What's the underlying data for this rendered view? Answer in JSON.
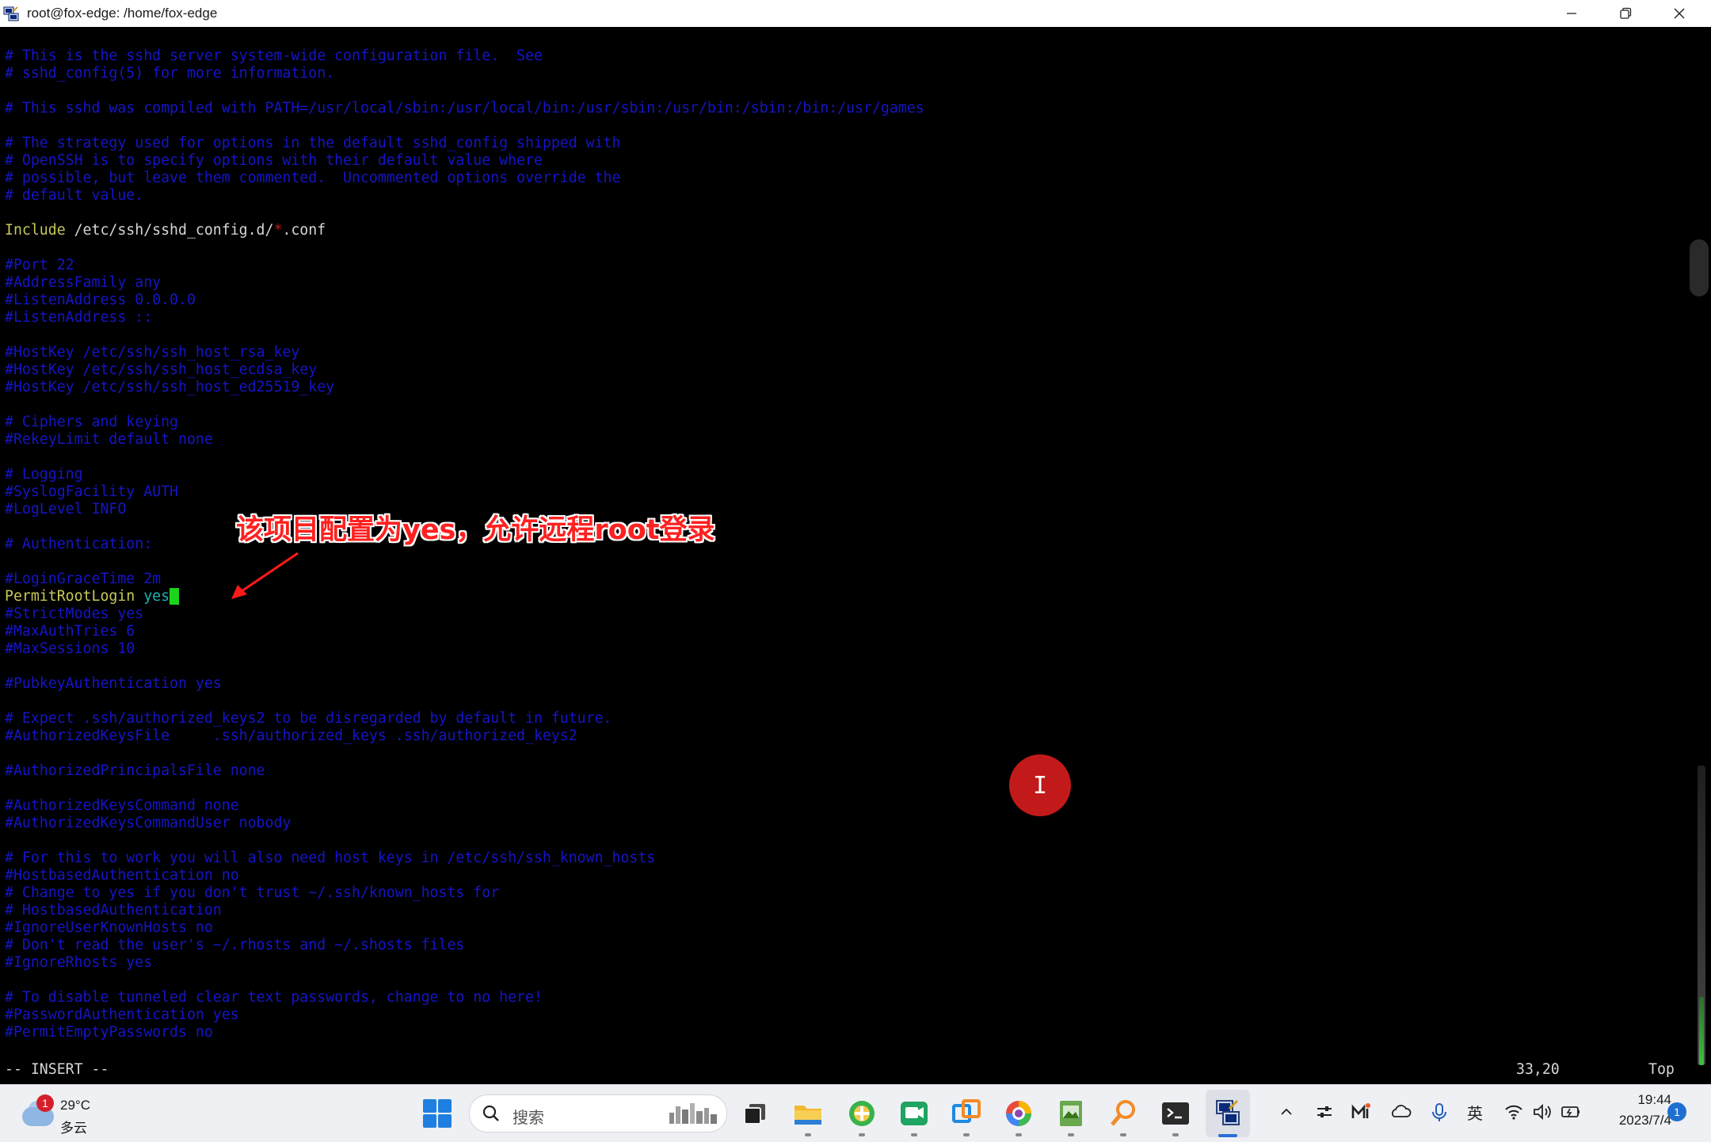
{
  "window": {
    "title": "root@fox-edge: /home/fox-edge"
  },
  "terminal": {
    "lines": [
      [
        {
          "t": "# This is the sshd server system-wide configuration file.  See",
          "c": "cm"
        }
      ],
      [
        {
          "t": "# sshd_config(5) for more information.",
          "c": "cm"
        }
      ],
      [],
      [
        {
          "t": "# This sshd was compiled with PATH=/usr/local/sbin:/usr/local/bin:/usr/sbin:/usr/bin:/sbin:/bin:/usr/games",
          "c": "cm"
        }
      ],
      [],
      [
        {
          "t": "# The strategy used for options in the default sshd_config shipped with",
          "c": "cm"
        }
      ],
      [
        {
          "t": "# OpenSSH is to specify options with their default value where",
          "c": "cm"
        }
      ],
      [
        {
          "t": "# possible, but leave them commented.  Uncommented options override the",
          "c": "cm"
        }
      ],
      [
        {
          "t": "# default value.",
          "c": "cm"
        }
      ],
      [],
      [
        {
          "t": "Include",
          "c": "kw"
        },
        {
          "t": " /etc/ssh/sshd_config.d/",
          "c": "fn"
        },
        {
          "t": "*",
          "c": "ar"
        },
        {
          "t": ".conf",
          "c": "fn"
        }
      ],
      [],
      [
        {
          "t": "#Port 22",
          "c": "cm"
        }
      ],
      [
        {
          "t": "#AddressFamily any",
          "c": "cm"
        }
      ],
      [
        {
          "t": "#ListenAddress 0.0.0.0",
          "c": "cm"
        }
      ],
      [
        {
          "t": "#ListenAddress ::",
          "c": "cm"
        }
      ],
      [],
      [
        {
          "t": "#HostKey /etc/ssh/ssh_host_rsa_key",
          "c": "cm"
        }
      ],
      [
        {
          "t": "#HostKey /etc/ssh/ssh_host_ecdsa_key",
          "c": "cm"
        }
      ],
      [
        {
          "t": "#HostKey /etc/ssh/ssh_host_ed25519_key",
          "c": "cm"
        }
      ],
      [],
      [
        {
          "t": "# Ciphers and keying",
          "c": "cm"
        }
      ],
      [
        {
          "t": "#RekeyLimit default none",
          "c": "cm"
        }
      ],
      [],
      [
        {
          "t": "# Logging",
          "c": "cm"
        }
      ],
      [
        {
          "t": "#SyslogFacility AUTH",
          "c": "cm"
        }
      ],
      [
        {
          "t": "#LogLevel INFO",
          "c": "cm"
        }
      ],
      [],
      [
        {
          "t": "# Authentication:",
          "c": "cm"
        }
      ],
      [],
      [
        {
          "t": "#LoginGraceTime 2m",
          "c": "cm"
        }
      ],
      [
        {
          "t": "PermitRootLogin",
          "c": "kw"
        },
        {
          "t": " ",
          "c": "fn"
        },
        {
          "t": "yes",
          "c": "yl"
        },
        {
          "t": "",
          "c": "cursor"
        }
      ],
      [
        {
          "t": "#StrictModes yes",
          "c": "cm"
        }
      ],
      [
        {
          "t": "#MaxAuthTries 6",
          "c": "cm"
        }
      ],
      [
        {
          "t": "#MaxSessions 10",
          "c": "cm"
        }
      ],
      [],
      [
        {
          "t": "#PubkeyAuthentication yes",
          "c": "cm"
        }
      ],
      [],
      [
        {
          "t": "# Expect .ssh/authorized_keys2 to be disregarded by default in future.",
          "c": "cm"
        }
      ],
      [
        {
          "t": "#AuthorizedKeysFile     .ssh/authorized_keys .ssh/authorized_keys2",
          "c": "cm"
        }
      ],
      [],
      [
        {
          "t": "#AuthorizedPrincipalsFile none",
          "c": "cm"
        }
      ],
      [],
      [
        {
          "t": "#AuthorizedKeysCommand none",
          "c": "cm"
        }
      ],
      [
        {
          "t": "#AuthorizedKeysCommandUser nobody",
          "c": "cm"
        }
      ],
      [],
      [
        {
          "t": "# For this to work you will also need host keys in /etc/ssh/ssh_known_hosts",
          "c": "cm"
        }
      ],
      [
        {
          "t": "#HostbasedAuthentication no",
          "c": "cm"
        }
      ],
      [
        {
          "t": "# Change to yes if you don't trust ~/.ssh/known_hosts for",
          "c": "cm"
        }
      ],
      [
        {
          "t": "# HostbasedAuthentication",
          "c": "cm"
        }
      ],
      [
        {
          "t": "#IgnoreUserKnownHosts no",
          "c": "cm"
        }
      ],
      [
        {
          "t": "# Don't read the user's ~/.rhosts and ~/.shosts files",
          "c": "cm"
        }
      ],
      [
        {
          "t": "#IgnoreRhosts yes",
          "c": "cm"
        }
      ],
      [],
      [
        {
          "t": "# To disable tunneled clear text passwords, change to no here!",
          "c": "cm"
        }
      ],
      [
        {
          "t": "#PasswordAuthentication yes",
          "c": "cm"
        }
      ],
      [
        {
          "t": "#PermitEmptyPasswords no",
          "c": "cm"
        }
      ]
    ],
    "status_mode": "-- INSERT --",
    "status_position": "33,20",
    "status_scroll": "Top",
    "annotation": "该项目配置为yes，允许远程root登录",
    "text_cursor_glyph": "I"
  },
  "taskbar": {
    "weather_badge": "1",
    "weather_temp": "29°C",
    "weather_cond": "多云",
    "search_placeholder": "搜索",
    "ime_label": "英",
    "time": "19:44",
    "date": "2023/7/4",
    "notification_count": "1"
  }
}
